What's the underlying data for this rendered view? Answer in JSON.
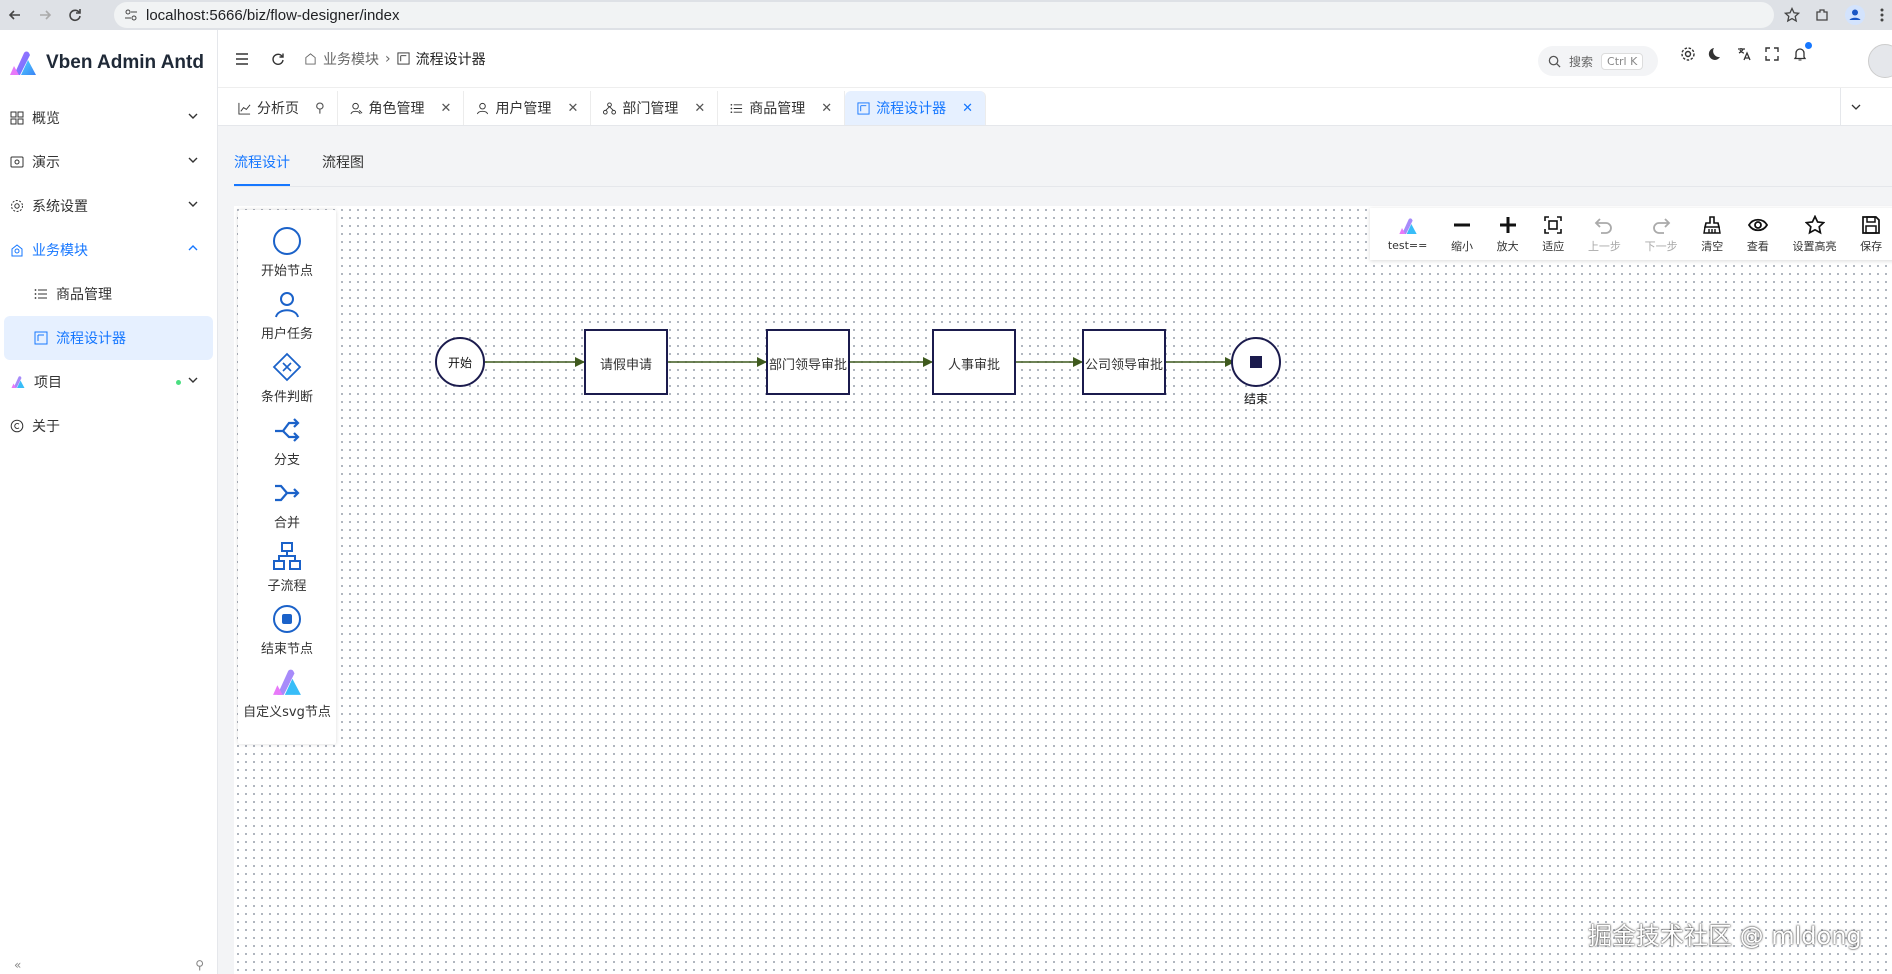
{
  "browser": {
    "url": "localhost:5666/biz/flow-designer/index"
  },
  "app": {
    "title": "Vben Admin Antd"
  },
  "sidebar": {
    "items": [
      {
        "label": "概览",
        "icon": "dashboard-icon"
      },
      {
        "label": "演示",
        "icon": "demo-icon"
      },
      {
        "label": "系统设置",
        "icon": "gear-icon"
      },
      {
        "label": "业务模块",
        "icon": "business-icon"
      },
      {
        "label": "商品管理",
        "icon": "list-icon"
      },
      {
        "label": "流程设计器",
        "icon": "flow-icon"
      },
      {
        "label": "项目",
        "icon": "vben-logo-icon"
      },
      {
        "label": "关于",
        "icon": "copyright-icon"
      }
    ]
  },
  "header": {
    "breadcrumb": [
      "业务模块",
      "流程设计器"
    ],
    "search_placeholder": "搜索",
    "search_shortcut": "Ctrl K"
  },
  "tabs": [
    {
      "label": "分析页"
    },
    {
      "label": "角色管理"
    },
    {
      "label": "用户管理"
    },
    {
      "label": "部门管理"
    },
    {
      "label": "商品管理"
    },
    {
      "label": "流程设计器"
    }
  ],
  "subtabs": [
    "流程设计",
    "流程图"
  ],
  "palette": [
    {
      "label": "开始节点",
      "icon": "start-circle-icon"
    },
    {
      "label": "用户任务",
      "icon": "user-task-icon"
    },
    {
      "label": "条件判断",
      "icon": "gateway-icon"
    },
    {
      "label": "分支",
      "icon": "fork-icon"
    },
    {
      "label": "合并",
      "icon": "merge-icon"
    },
    {
      "label": "子流程",
      "icon": "subprocess-icon"
    },
    {
      "label": "结束节点",
      "icon": "end-circle-icon"
    },
    {
      "label": "自定义svg节点",
      "icon": "custom-svg-icon"
    }
  ],
  "toolbar": [
    {
      "label": "test==",
      "icon": "vben-logo-icon"
    },
    {
      "label": "缩小",
      "icon": "zoom-out-icon"
    },
    {
      "label": "放大",
      "icon": "zoom-in-icon"
    },
    {
      "label": "适应",
      "icon": "fit-icon"
    },
    {
      "label": "上一步",
      "icon": "undo-icon",
      "disabled": true
    },
    {
      "label": "下一步",
      "icon": "redo-icon",
      "disabled": true
    },
    {
      "label": "清空",
      "icon": "clear-icon"
    },
    {
      "label": "查看",
      "icon": "eye-icon"
    },
    {
      "label": "设置高亮",
      "icon": "star-icon"
    },
    {
      "label": "保存",
      "icon": "save-icon"
    }
  ],
  "flow": {
    "start_label": "开始",
    "tasks": [
      "请假申请",
      "部门领导审批",
      "人事审批",
      "公司领导审批"
    ],
    "end_label": "结束",
    "edge_color": "#3f5a1e",
    "node_color": "#1b1b4d"
  },
  "watermark": "掘金技术社区 @ mldong",
  "colors": {
    "accent": "#1677ff",
    "node_stroke": "#1b1b4d",
    "edge": "#3f5a1e"
  }
}
